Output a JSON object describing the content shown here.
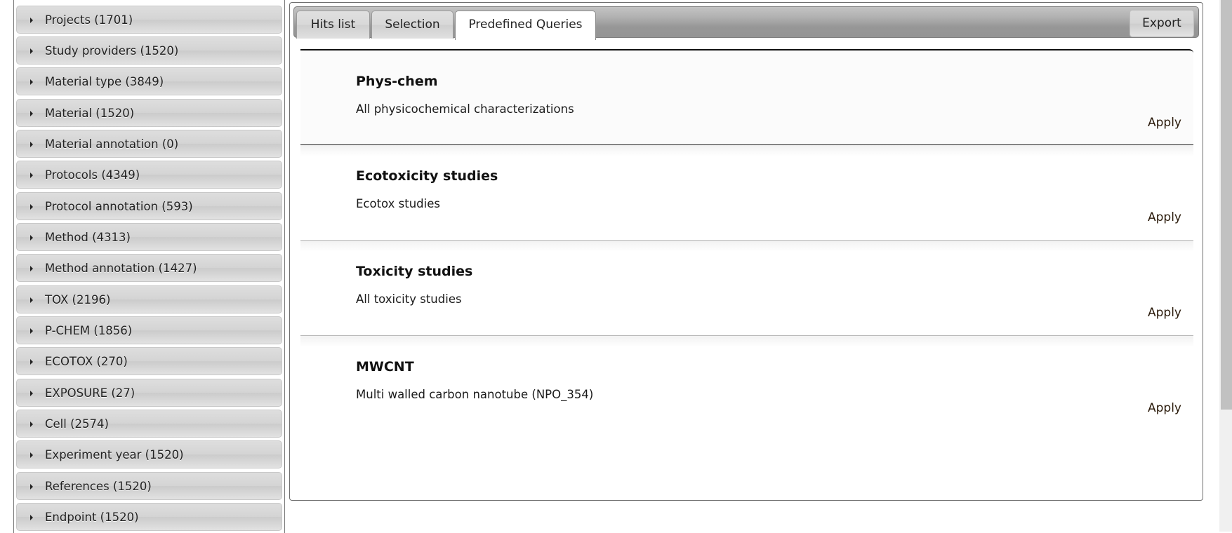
{
  "sidebar": {
    "facets": [
      {
        "label": "Projects (1701)"
      },
      {
        "label": "Study providers (1520)"
      },
      {
        "label": "Material type (3849)"
      },
      {
        "label": "Material (1520)"
      },
      {
        "label": "Material annotation (0)"
      },
      {
        "label": "Protocols (4349)"
      },
      {
        "label": "Protocol annotation (593)"
      },
      {
        "label": "Method (4313)"
      },
      {
        "label": "Method annotation (1427)"
      },
      {
        "label": "TOX (2196)"
      },
      {
        "label": "P-CHEM (1856)"
      },
      {
        "label": "ECOTOX (270)"
      },
      {
        "label": "EXPOSURE (27)"
      },
      {
        "label": "Cell (2574)"
      },
      {
        "label": "Experiment year (1520)"
      },
      {
        "label": "References (1520)"
      },
      {
        "label": "Endpoint (1520)"
      }
    ],
    "expand_icon": "triangle-right-icon"
  },
  "main": {
    "tabs": [
      {
        "label": "Hits list",
        "active": false
      },
      {
        "label": "Selection",
        "active": false
      },
      {
        "label": "Predefined Queries",
        "active": true
      }
    ],
    "export_label": "Export",
    "queries": [
      {
        "title": "Phys-chem",
        "description": "All physicochemical characterizations",
        "action": "Apply"
      },
      {
        "title": "Ecotoxicity studies",
        "description": "Ecotox studies",
        "action": "Apply"
      },
      {
        "title": "Toxicity studies",
        "description": "All toxicity studies",
        "action": "Apply"
      },
      {
        "title": "MWCNT",
        "description": "Multi walled carbon nanotube (NPO_354)",
        "action": "Apply"
      }
    ]
  },
  "colors": {
    "tabbar_top": "#c4c4c4",
    "tabbar_bottom": "#949494",
    "facet_bg": "#d6d6d6",
    "scroll_thumb": "#c1c1c1"
  }
}
